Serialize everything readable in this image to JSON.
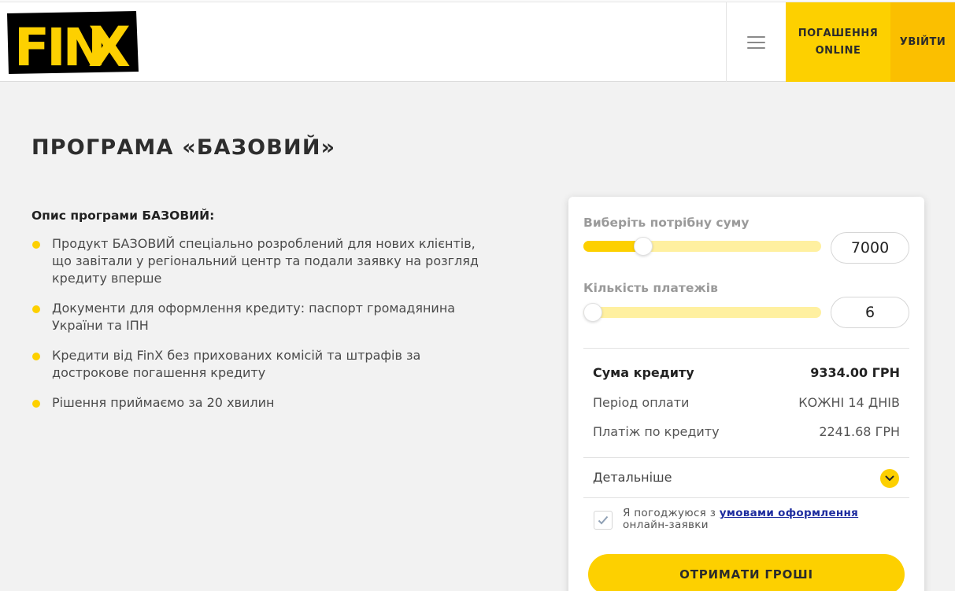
{
  "brand": {
    "logo_text": "FinX",
    "accent": "#fdd000",
    "accent_dark": "#fbbf00"
  },
  "header": {
    "menu_icon": "hamburger-icon",
    "pay_online_line1": "ПОГАШЕННЯ",
    "pay_online_line2": "ONLINE",
    "login_label": "УВІЙТИ"
  },
  "page": {
    "title": "ПРОГРАМА «БАЗОВИЙ»",
    "description_heading": "Опис програми БАЗОВИЙ:",
    "bullets": [
      [
        "Продукт БАЗОВИЙ спеціально розроблений для нових клієнтів,",
        "що завітали у регіональний центр та подали заявку на розгляд",
        "кредиту вперше"
      ],
      [
        "Документи для оформлення кредиту: паспорт громадянина",
        "України та ІПН"
      ],
      [
        "Кредити від FinX без прихованих комісій та штрафів за",
        "дострокове погашення кредиту"
      ],
      [
        "Рішення приймаємо за 20 хвилин"
      ]
    ]
  },
  "calculator": {
    "amount_label": "Виберіть потрібну суму",
    "amount_value": "7000",
    "amount_slider_fraction": 0.25,
    "payments_label": "Кількість платежів",
    "payments_value": "6",
    "payments_slider_fraction": 0.0,
    "summary": [
      {
        "label": "Сума кредиту",
        "value": "9334.00 ГРН",
        "bold": true
      },
      {
        "label": "Період оплати",
        "value": "КОЖНІ 14 ДНІВ",
        "bold": false
      },
      {
        "label": "Платіж по кредиту",
        "value": "2241.68 ГРН",
        "bold": false
      }
    ],
    "details_label": "Детальніше",
    "details_icon": "chevron-down-icon",
    "agree_checked": true,
    "agree_prefix": "Я погоджуюся з",
    "agree_link": "умовами оформлення",
    "agree_suffix": "онлайн-заявки",
    "cta_label": "ОТРИМАТИ ГРОШІ"
  }
}
